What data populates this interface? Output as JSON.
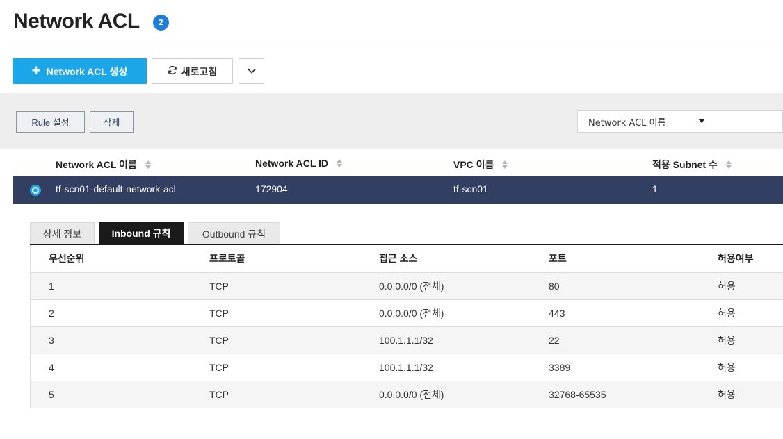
{
  "page": {
    "title": "Network ACL",
    "count": "2"
  },
  "toolbar": {
    "create_label": "Network ACL 생성",
    "refresh_label": "새로고침"
  },
  "actions": {
    "rule_settings_label": "Rule 설정",
    "delete_label": "삭제"
  },
  "filter": {
    "selected": "Network ACL 이름",
    "search_value": ""
  },
  "acl_table": {
    "columns": [
      "Network ACL 이름",
      "Network ACL ID",
      "VPC 이름",
      "적용 Subnet 수"
    ],
    "rows": [
      {
        "name": "tf-scn01-default-network-acl",
        "id": "172904",
        "vpc": "tf-scn01",
        "subnet_count": "1",
        "selected": true
      }
    ]
  },
  "tabs": [
    {
      "label": "상세 정보",
      "active": false
    },
    {
      "label": "Inbound 규칙",
      "active": true
    },
    {
      "label": "Outbound 규칙",
      "active": false
    }
  ],
  "inbound": {
    "columns": [
      "우선순위",
      "프로토콜",
      "접근 소스",
      "포트",
      "허용여부"
    ],
    "rows": [
      {
        "priority": "1",
        "protocol": "TCP",
        "source": "0.0.0.0/0 (전체)",
        "port": "80",
        "allow": "허용"
      },
      {
        "priority": "2",
        "protocol": "TCP",
        "source": "0.0.0.0/0 (전체)",
        "port": "443",
        "allow": "허용"
      },
      {
        "priority": "3",
        "protocol": "TCP",
        "source": "100.1.1.1/32",
        "port": "22",
        "allow": "허용"
      },
      {
        "priority": "4",
        "protocol": "TCP",
        "source": "100.1.1.1/32",
        "port": "3389",
        "allow": "허용"
      },
      {
        "priority": "5",
        "protocol": "TCP",
        "source": "0.0.0.0/0 (전체)",
        "port": "32768-65535",
        "allow": "허용"
      }
    ]
  },
  "colors": {
    "primary": "#1aa6e8",
    "badge": "#1f7fd6",
    "selected_row": "#323e62",
    "active_tab": "#1a1a1a"
  },
  "icons": {
    "create": "plus-icon",
    "refresh": "refresh-icon",
    "more": "chevron-down-icon",
    "sort": "sort-icon",
    "filter_caret": "caret-down-icon",
    "row_select": "radio-icon"
  }
}
